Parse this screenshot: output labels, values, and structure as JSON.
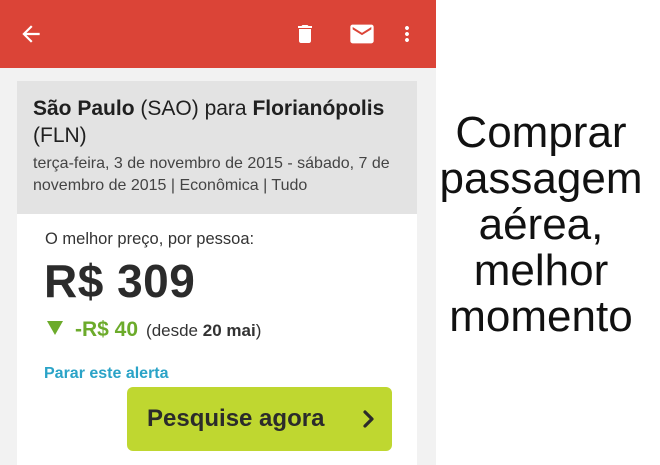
{
  "app": {
    "accent": "#db4437"
  },
  "toolbar": {
    "icons": [
      "arrow-back-icon",
      "delete-icon",
      "mail-icon",
      "more-vert-icon"
    ]
  },
  "trip": {
    "origin_city": "São Paulo",
    "origin_code": "(SAO)",
    "connector": "para",
    "destination_city": "Florianópolis",
    "destination_code": "(FLN)",
    "dates": "terça-feira, 3 de novembro de 2015 - sábado, 7 de novembro de 2015 | Econômica | Tudo"
  },
  "price": {
    "label": "O melhor preço, por pessoa:",
    "value": "R$ 309",
    "drop_amount": "-R$ 40",
    "since_prefix": "(desde",
    "since_date": "20 mai",
    "since_suffix": ")",
    "drop_color": "#6cab2b"
  },
  "actions": {
    "stop_alert": "Parar este alerta",
    "search_now": "Pesquise agora",
    "search_color": "#bfd730"
  },
  "caption": {
    "lines": [
      "Comprar",
      "passagem",
      "aérea,",
      "melhor",
      "momento"
    ]
  }
}
